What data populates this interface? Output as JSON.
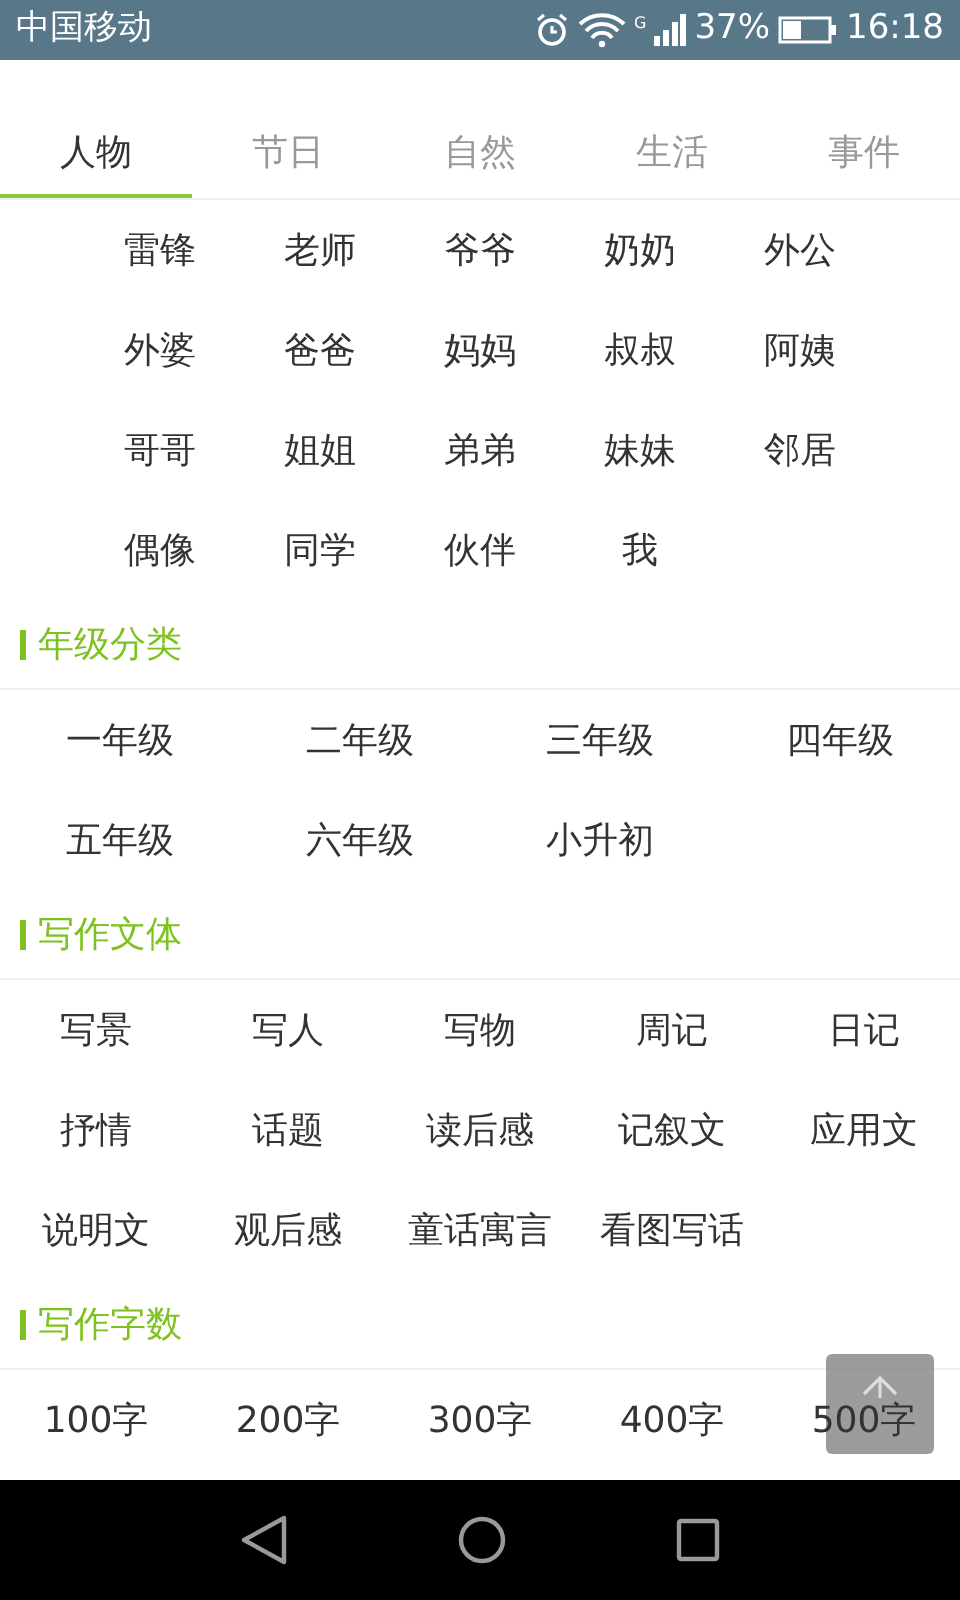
{
  "status_bar": {
    "carrier": "中国移动",
    "network_type": "G",
    "battery": "37%",
    "time": "16:18"
  },
  "tabs": [
    {
      "label": "人物",
      "selected": true
    },
    {
      "label": "节日",
      "selected": false
    },
    {
      "label": "自然",
      "selected": false
    },
    {
      "label": "生活",
      "selected": false
    },
    {
      "label": "事件",
      "selected": false
    }
  ],
  "tab_items": [
    "雷锋",
    "老师",
    "爷爷",
    "奶奶",
    "外公",
    "外婆",
    "爸爸",
    "妈妈",
    "叔叔",
    "阿姨",
    "哥哥",
    "姐姐",
    "弟弟",
    "妹妹",
    "邻居",
    "偶像",
    "同学",
    "伙伴",
    "我"
  ],
  "sections": [
    {
      "title": "年级分类",
      "kind": "grid4",
      "items": [
        "一年级",
        "二年级",
        "三年级",
        "四年级",
        "五年级",
        "六年级",
        "小升初"
      ]
    },
    {
      "title": "写作文体",
      "kind": "grid5",
      "items": [
        "写景",
        "写人",
        "写物",
        "周记",
        "日记",
        "抒情",
        "话题",
        "读后感",
        "记叙文",
        "应用文",
        "说明文",
        "观后感",
        "童话寓言",
        "看图写话"
      ]
    },
    {
      "title": "写作字数",
      "kind": "grid5",
      "items": [
        "100字",
        "200字",
        "300字",
        "400字",
        "500字"
      ]
    }
  ]
}
